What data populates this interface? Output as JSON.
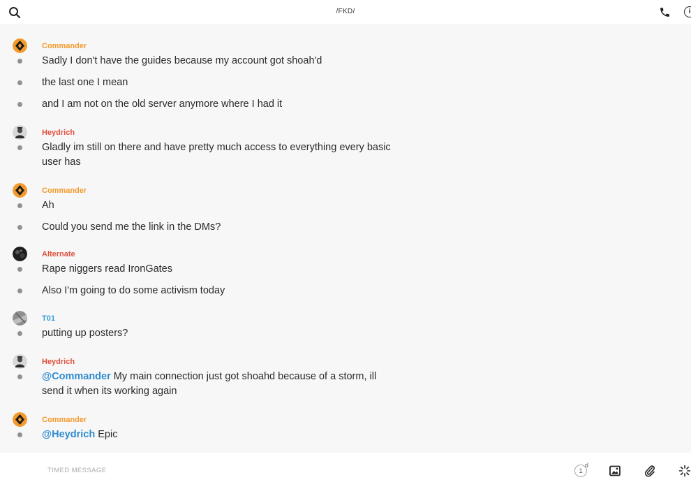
{
  "header": {
    "title": "/FKD/",
    "info_glyph": "i"
  },
  "colors": {
    "commander": "#f39a2c",
    "heydrich": "#e0523f",
    "alternate": "#e0523f",
    "t01": "#3a9ed8",
    "mention": "#2f8ccf"
  },
  "messages": [
    {
      "author": "Commander",
      "lines": [
        "Sadly I don't have the guides because my account got shoah'd",
        "the last one I mean",
        "and I am not on the old server anymore where I had it"
      ]
    },
    {
      "author": "Heydrich",
      "lines": [
        "Gladly im still on there and have pretty much access to everything every basic user has"
      ]
    },
    {
      "author": "Commander",
      "lines": [
        "Ah",
        "Could you send me the link in the DMs?"
      ]
    },
    {
      "author": "Alternate",
      "lines": [
        "Rape niggers read IronGates",
        "Also I'm going to do some activism today"
      ]
    },
    {
      "author": "T01",
      "lines": [
        "putting up posters?"
      ]
    },
    {
      "author": "Heydrich",
      "mention": "@Commander",
      "lines": [
        " My main connection just got shoahd because of a storm, ill send it when its working again"
      ]
    },
    {
      "author": "Commander",
      "mention": "@Heydrich",
      "lines": [
        " Epic"
      ]
    }
  ],
  "composer": {
    "placeholder": "TIMED MESSAGE",
    "timer_value": "1",
    "timer_unit": "d"
  },
  "icons": [
    "search-icon",
    "phone-icon",
    "info-icon",
    "timer-icon",
    "image-icon",
    "paperclip-icon",
    "sparkle-icon"
  ]
}
